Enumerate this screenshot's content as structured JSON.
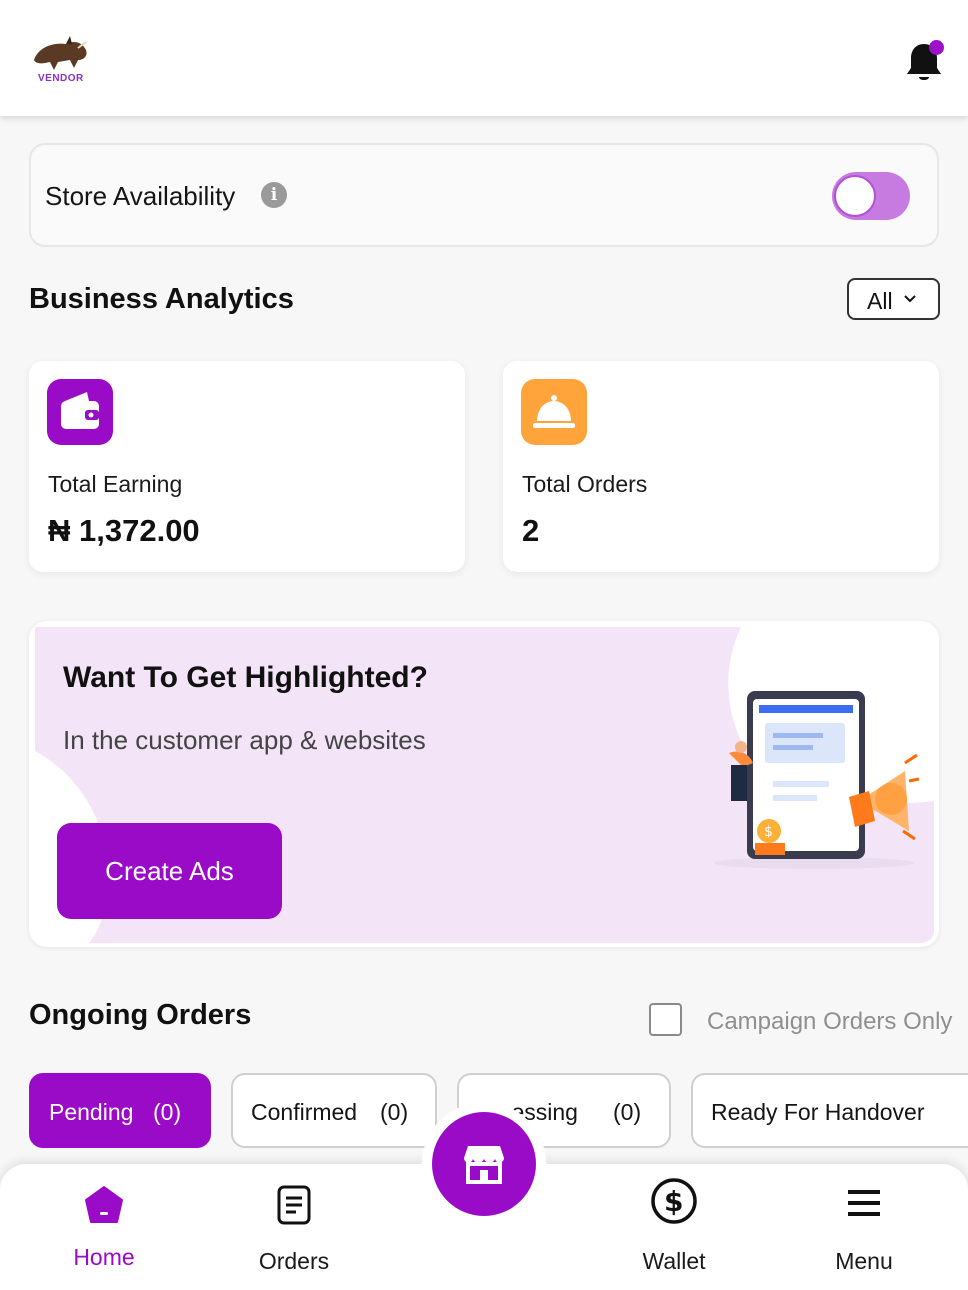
{
  "header": {
    "logo_text": "VENDOR",
    "notification_dot": true
  },
  "store": {
    "title": "Store Availability",
    "info_icon": "i",
    "available": false
  },
  "analytics": {
    "title": "Business Analytics",
    "filter": "All",
    "cards": [
      {
        "label": "Total Earning",
        "value": "₦ 1,372.00",
        "icon": "wallet-icon",
        "color": "#9a0bc8"
      },
      {
        "label": "Total Orders",
        "value": "2",
        "icon": "service-bell-icon",
        "color": "#ffa43a"
      }
    ]
  },
  "ads": {
    "title": "Want To Get Highlighted?",
    "subtitle": "In the customer app & websites",
    "button": "Create Ads"
  },
  "orders": {
    "title": "Ongoing Orders",
    "campaign_only_label": "Campaign Orders Only",
    "tabs": [
      {
        "label": "Pending",
        "count": "(0)",
        "active": true
      },
      {
        "label": "Confirmed",
        "count": "(0)",
        "active": false
      },
      {
        "label": "Processing",
        "count": "(0)",
        "active": false
      },
      {
        "label": "Ready For Handover",
        "count": "",
        "active": false
      }
    ],
    "processing_visible": "···cessing"
  },
  "nav": {
    "items": [
      {
        "label": "Home",
        "icon": "home-icon",
        "active": true
      },
      {
        "label": "Orders",
        "icon": "orders-icon",
        "active": false
      },
      {
        "label": "Wallet",
        "icon": "wallet-dollar-icon",
        "active": false
      },
      {
        "label": "Menu",
        "icon": "menu-icon",
        "active": false
      }
    ],
    "center_icon": "store-icon"
  },
  "colors": {
    "primary": "#9a0bc8",
    "orange": "#ffa43a",
    "ads_bg": "#f3e4f7"
  }
}
